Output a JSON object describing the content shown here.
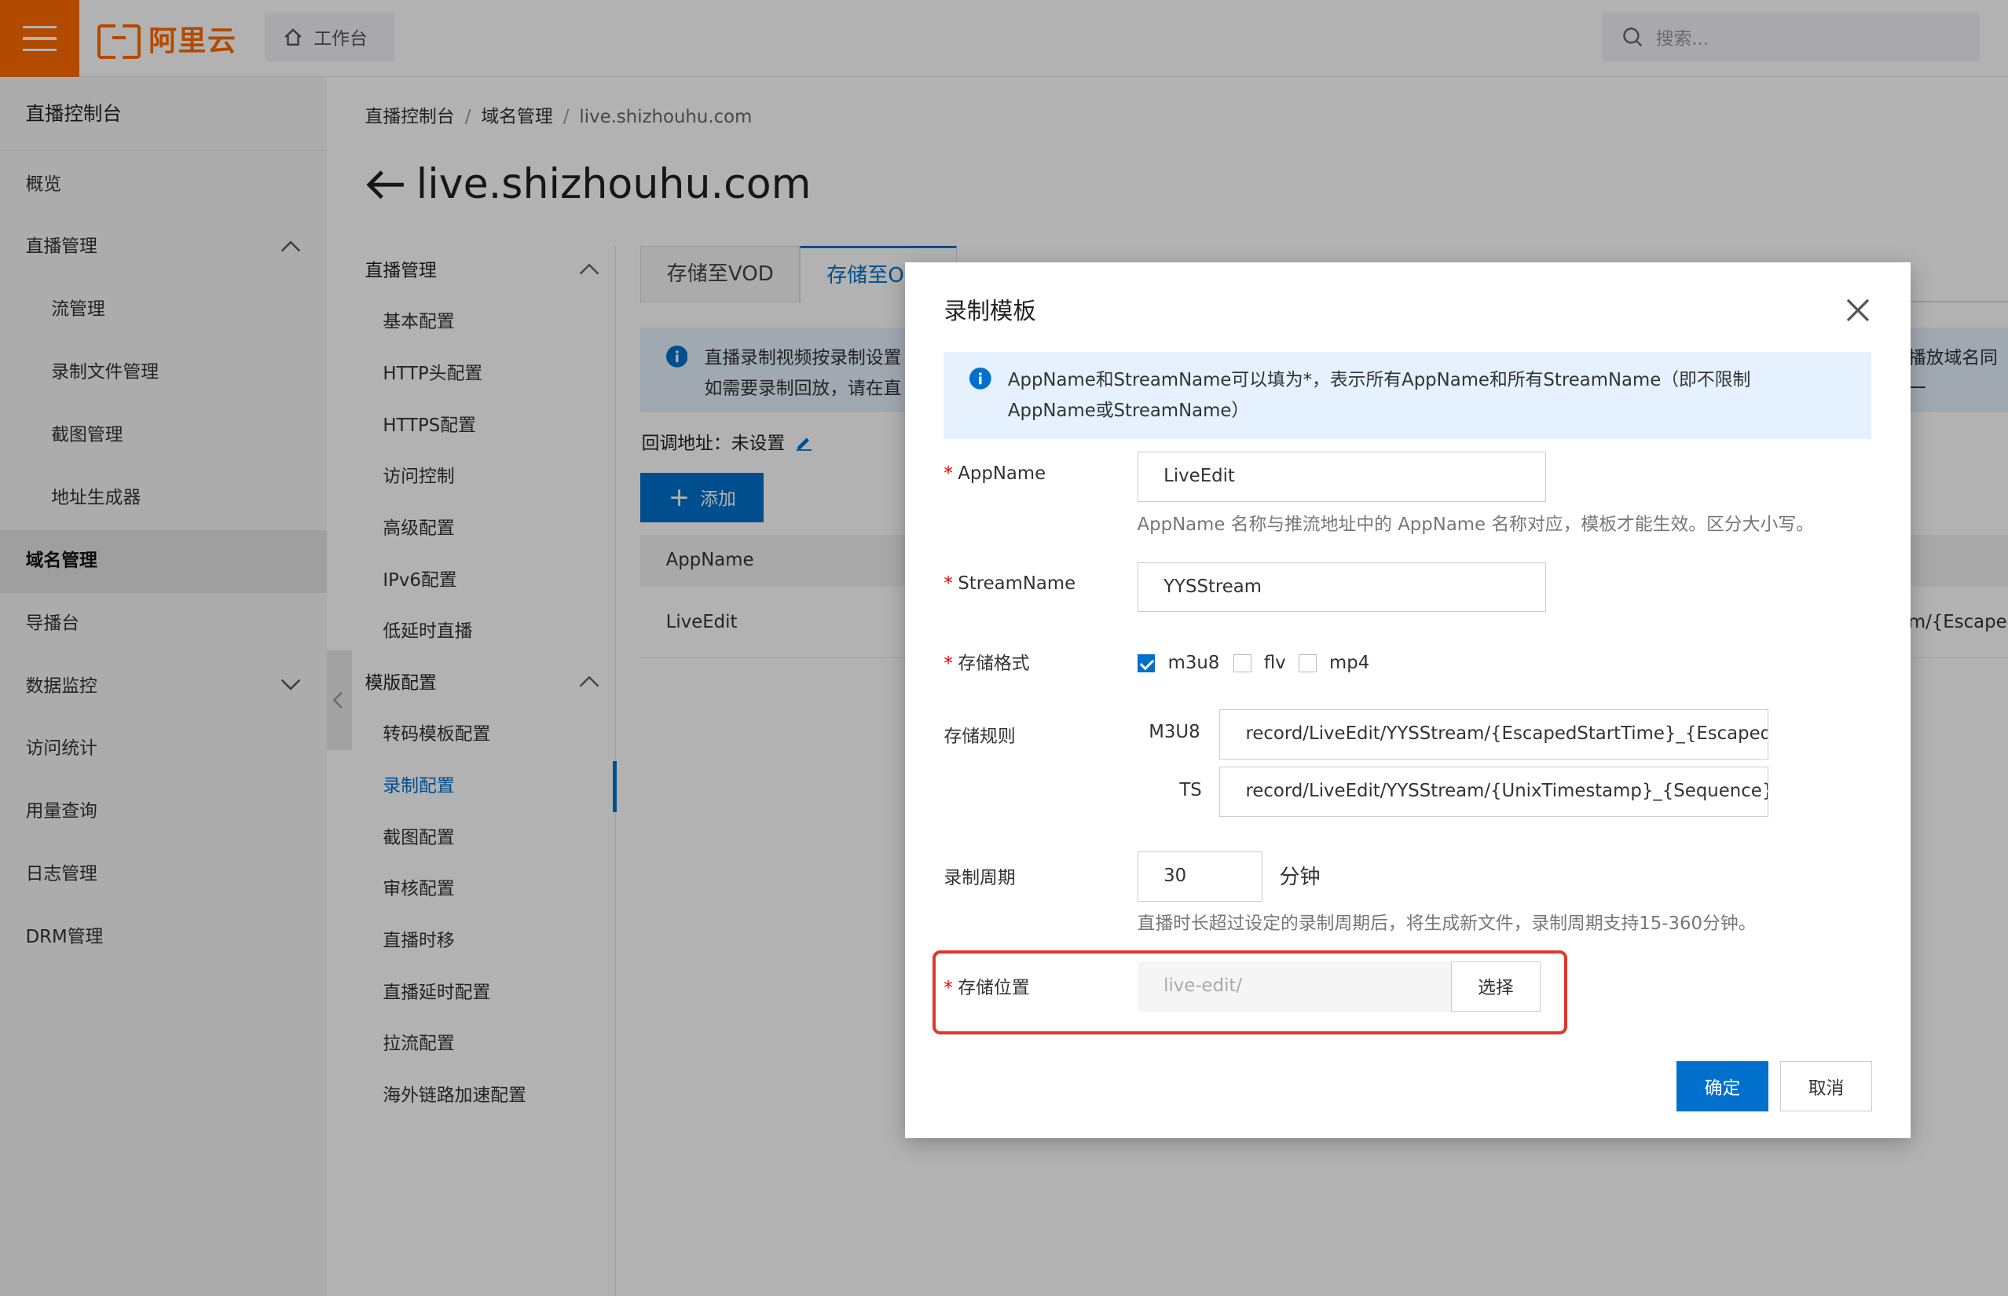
{
  "topbar": {
    "logo_text": "阿里云",
    "workbench_label": "工作台",
    "search_placeholder": "搜索..."
  },
  "leftnav": {
    "title": "直播控制台",
    "items": [
      {
        "label": "概览"
      },
      {
        "label": "直播管理"
      },
      {
        "label": "流管理"
      },
      {
        "label": "录制文件管理"
      },
      {
        "label": "截图管理"
      },
      {
        "label": "地址生成器"
      },
      {
        "label": "域名管理"
      },
      {
        "label": "导播台"
      },
      {
        "label": "数据监控"
      },
      {
        "label": "访问统计"
      },
      {
        "label": "用量查询"
      },
      {
        "label": "日志管理"
      },
      {
        "label": "DRM管理"
      }
    ]
  },
  "breadcrumb": [
    "直播控制台",
    "域名管理",
    "live.shizhouhu.com"
  ],
  "page_title": "live.shizhouhu.com",
  "subnav": {
    "group1": "直播管理",
    "group1_items": [
      "基本配置",
      "HTTP头配置",
      "HTTPS配置",
      "访问控制",
      "高级配置",
      "IPv6配置",
      "低延时直播"
    ],
    "group2": "模版配置",
    "group2_items": [
      "转码模板配置",
      "录制配置",
      "截图配置",
      "审核配置",
      "直播时移",
      "直播延时配置",
      "拉流配置",
      "海外链路加速配置"
    ]
  },
  "tabs": [
    "存储至VOD",
    "存储至OSS"
  ],
  "notice": {
    "line1": "直播录制视频按录制设置",
    "line2": "如需要录制回放，请在直",
    "right": "播放域名同一"
  },
  "callback": "回调地址：未设置",
  "add_button": "添加",
  "table": {
    "header": "AppName",
    "row_app": "LiveEdit",
    "row_right": "m/{Escaped"
  },
  "dialog": {
    "title": "录制模板",
    "note": "AppName和StreamName可以填为*，表示所有AppName和所有StreamName（即不限制AppName或StreamName）",
    "appname_label": "AppName",
    "appname_value": "LiveEdit",
    "appname_hint": "AppName 名称与推流地址中的 AppName 名称对应，模板才能生效。区分大小写。",
    "streamname_label": "StreamName",
    "streamname_value": "YYSStream",
    "format_label": "存储格式",
    "formats": [
      {
        "label": "m3u8",
        "checked": true
      },
      {
        "label": "flv",
        "checked": false
      },
      {
        "label": "mp4",
        "checked": false
      }
    ],
    "rule_label": "存储规则",
    "m3u8_label": "M3U8",
    "m3u8_value": "record/LiveEdit/YYSStream/{EscapedStartTime}_{EscapedEndTime}",
    "ts_label": "TS",
    "ts_value": "record/LiveEdit/YYSStream/{UnixTimestamp}_{Sequence}",
    "period_label": "录制周期",
    "period_value": "30",
    "period_unit": "分钟",
    "period_hint": "直播时长超过设定的录制周期后，将生成新文件，录制周期支持15-360分钟。",
    "location_label": "存储位置",
    "location_placeholder": "live-edit/",
    "select_button": "选择",
    "confirm_button": "确定",
    "cancel_button": "取消"
  },
  "colors": {
    "brand_orange": "#ff6a00",
    "primary_blue": "#0070cc",
    "highlight_red": "#e0352b",
    "info_bg": "#e5f1ff"
  }
}
